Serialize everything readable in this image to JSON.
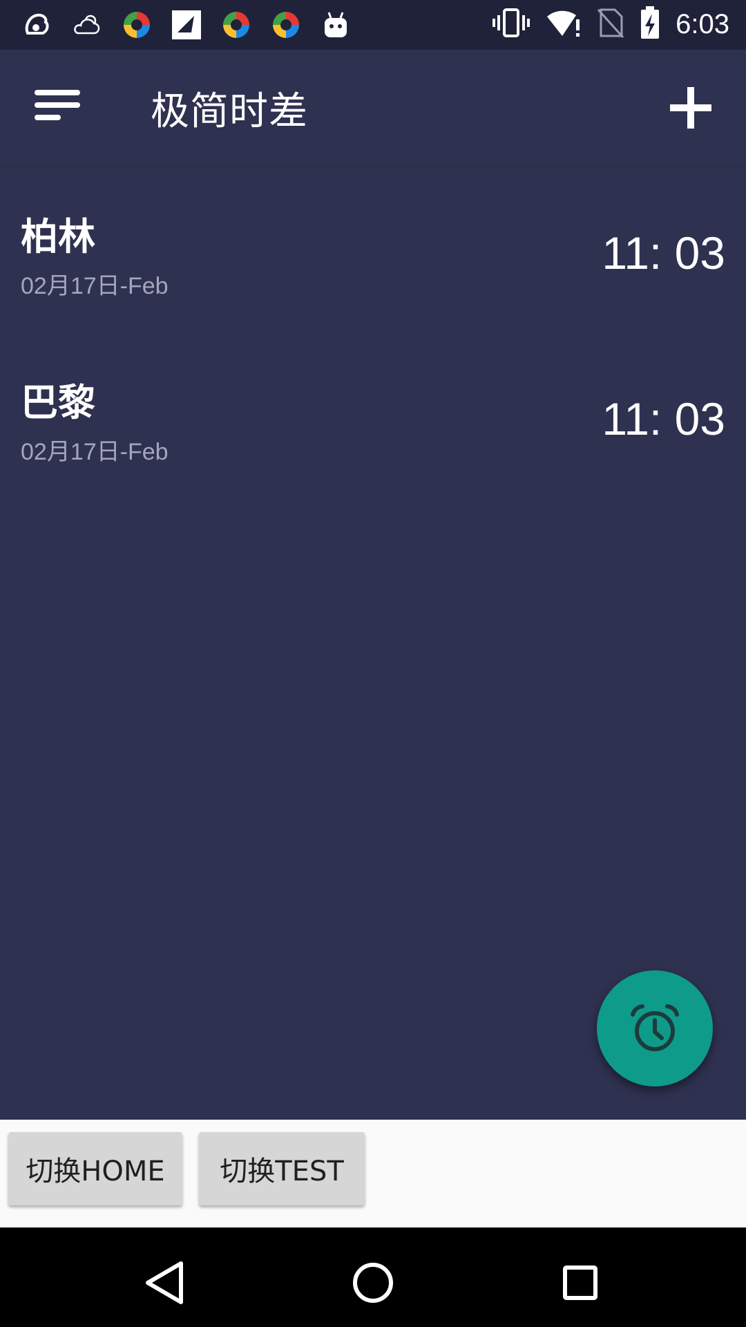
{
  "status_bar": {
    "time": "6:03",
    "left_icons": [
      "uc-browser-icon",
      "weather-icon",
      "app-icon",
      "app-icon",
      "app-icon",
      "app-icon",
      "android-icon"
    ],
    "right_icons": [
      "vibrate-icon",
      "wifi-icon",
      "no-sim-icon",
      "battery-charging-icon"
    ]
  },
  "app_bar": {
    "title": "极简时差",
    "menu_icon": "menu-icon",
    "add_icon": "plus-icon"
  },
  "clocks": [
    {
      "city": "柏林",
      "date": "02月17日-Feb",
      "time": "11: 03"
    },
    {
      "city": "巴黎",
      "date": "02月17日-Feb",
      "time": "11: 03"
    }
  ],
  "fab": {
    "icon": "alarm-clock-icon",
    "color": "#0e9b8a"
  },
  "buttons": {
    "switch_home": "切换HOME",
    "switch_test": "切换TEST"
  },
  "nav_bar": {
    "back": "back-icon",
    "home": "home-icon",
    "recents": "recents-icon"
  },
  "colors": {
    "background": "#2f3150",
    "status_bar": "#20223a",
    "accent": "#0e9b8a"
  }
}
